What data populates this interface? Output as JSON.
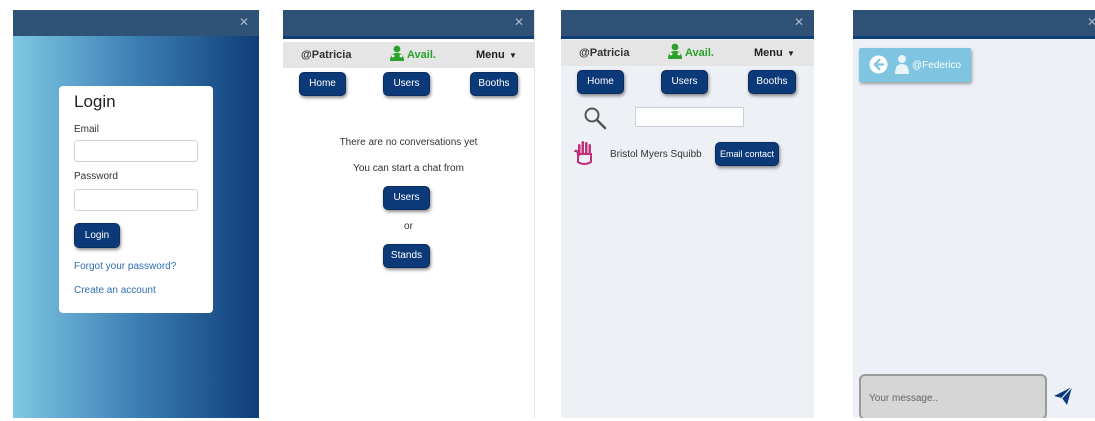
{
  "login": {
    "title": "Login",
    "email_label": "Email",
    "password_label": "Password",
    "login_button": "Login",
    "forgot_link": "Forgot your password?",
    "create_link": "Create an account"
  },
  "status": {
    "user": "@Patricia",
    "availability": "Avail.",
    "menu": "Menu"
  },
  "nav": {
    "home": "Home",
    "users": "Users",
    "booths": "Booths"
  },
  "conversations": {
    "empty_line1": "There are no conversations yet",
    "empty_line2": "You can start a chat from",
    "users_button": "Users",
    "or_text": "or",
    "stands_button": "Stands"
  },
  "booth_list": {
    "items": [
      {
        "company": "Bristol Myers Squibb",
        "action": "Email contact"
      }
    ]
  },
  "chat": {
    "user": "@Federico",
    "placeholder": "Your message.."
  },
  "colors": {
    "brand": "#0c3a78",
    "titlebar": "#2f5176",
    "accent": "#7fc4e0",
    "available": "#2aa22a"
  },
  "icons": [
    "close-icon",
    "user-available-icon",
    "chevron-down-icon",
    "search-icon",
    "hand-icon",
    "back-arrow-icon",
    "user-icon",
    "send-icon"
  ]
}
